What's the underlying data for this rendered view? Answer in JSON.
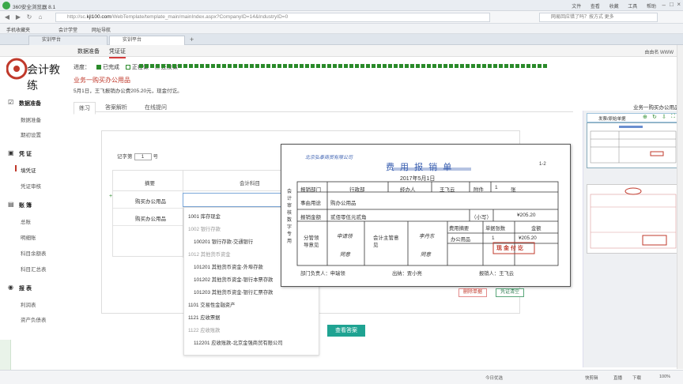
{
  "browser": {
    "title": "360安全浏览器 8.1",
    "menu": [
      "文件",
      "查看",
      "收藏",
      "工具",
      "帮助"
    ],
    "url_prefix": "http://sc.",
    "url_domain": "kjl100.com",
    "url_path": "/WebTemplate/template_main/mainIndex.aspx?CompanyID=14&IndustryID=0",
    "search_placeholder": "网易回应错了吗？按方式 更多",
    "bookmarks": [
      "手机收藏夹",
      "会计学堂",
      "网址导航"
    ],
    "tabs": [
      "实训平台",
      "实训平台"
    ]
  },
  "app": {
    "header_tabs": [
      "数据准备",
      "凭证证"
    ],
    "user": "由由名 WWW",
    "brand": "会计教练"
  },
  "sidebar": {
    "groups": [
      {
        "label": "数据准备",
        "items": [
          "数据准备",
          "期初设置"
        ]
      },
      {
        "label": "凭 证",
        "items": [
          "填凭证",
          "凭证审核"
        ]
      },
      {
        "label": "账 簿",
        "items": [
          "总账",
          "明细账",
          "科目余额表",
          "科目汇总表"
        ]
      },
      {
        "label": "报 表",
        "items": [
          "利润表",
          "资产负债表"
        ]
      }
    ]
  },
  "status_legend": {
    "label": "进度：",
    "items": [
      {
        "label": "已完成",
        "color": "#2a8a2a"
      },
      {
        "label": "正在做",
        "color": "#ffffff"
      },
      {
        "label": "还没做",
        "color": "#cccccc"
      }
    ]
  },
  "question": {
    "title": "业务一购买办公用品",
    "desc": "5月1日，王飞报销办公费205.20元，现金付讫。",
    "tabs": [
      "练习",
      "答案解析",
      "在线提问"
    ],
    "right_title": "业务一购买办公用品"
  },
  "voucher": {
    "no_label": "记字第",
    "no_value": "1",
    "no_suffix": "号",
    "col_summary": "摘要",
    "col_subject": "会计科目",
    "rows": [
      "购买办公用品",
      "购买办公用品"
    ],
    "btn_delete": "删除单据",
    "btn_clear": "凭证清空",
    "check": "查看答案"
  },
  "dropdown": [
    {
      "text": "1001  库存现金",
      "muted": false,
      "indent": false
    },
    {
      "text": "1002  银行存款",
      "muted": true,
      "indent": false
    },
    {
      "text": "100201  银行存款-交通银行",
      "muted": false,
      "indent": true
    },
    {
      "text": "1012  其他货币资金",
      "muted": true,
      "indent": false
    },
    {
      "text": "101201  其他货币资金-外埠存款",
      "muted": false,
      "indent": true
    },
    {
      "text": "101202  其他货币资金-银行本票存款",
      "muted": false,
      "indent": true
    },
    {
      "text": "101203  其他货币资金-银行汇票存款",
      "muted": false,
      "indent": true
    },
    {
      "text": "1101  交易性金融资产",
      "muted": false,
      "indent": false
    },
    {
      "text": "1121  应收票据",
      "muted": false,
      "indent": false
    },
    {
      "text": "1122  应收账款",
      "muted": true,
      "indent": false
    },
    {
      "text": "112201  应收账款-北京金强商贸有限公司",
      "muted": false,
      "indent": true
    }
  ],
  "receipt": {
    "company": "北京弘泰商贸有限公司",
    "title": "费 用 报 销 单",
    "date": "2017年5月1日",
    "page": "1-2",
    "side": "会计审核数字专用",
    "dept_label": "报销部门",
    "dept": "行政部",
    "handler_label": "经办人",
    "handler": "王飞云",
    "attach_label": "附件",
    "attach_count": "1",
    "attach_unit": "张",
    "purpose_label": "事由用途",
    "purpose": "购办公用品",
    "amount_label": "报销金额",
    "amount_words": "贰佰零伍元贰角",
    "amount_small": "（小写）",
    "amount": "¥205.20",
    "dept_approve": "分管领导意见",
    "approve1": "申请领",
    "approve2": "同意",
    "finance": "会计主管意见",
    "finance2": "同意",
    "boss1": "李丹东",
    "boss2": "同意",
    "detail_h1": "费用摘要",
    "detail_h2": "单据张数",
    "detail_h3": "金额",
    "detail_item": "办公用品",
    "detail_count": "1",
    "detail_amt": "¥205.20",
    "stamp": "现 金 付 讫",
    "sign1": "部门负责人：申瑞领",
    "sign2": "出纳：贾小亮",
    "sign3": "报销人：王飞云"
  },
  "right_panel": {
    "toolbar": "发票/原始单据"
  },
  "statusbar": {
    "left": "今日优选",
    "items": [
      "快剪辑",
      "直播",
      "下载",
      "100%"
    ]
  }
}
